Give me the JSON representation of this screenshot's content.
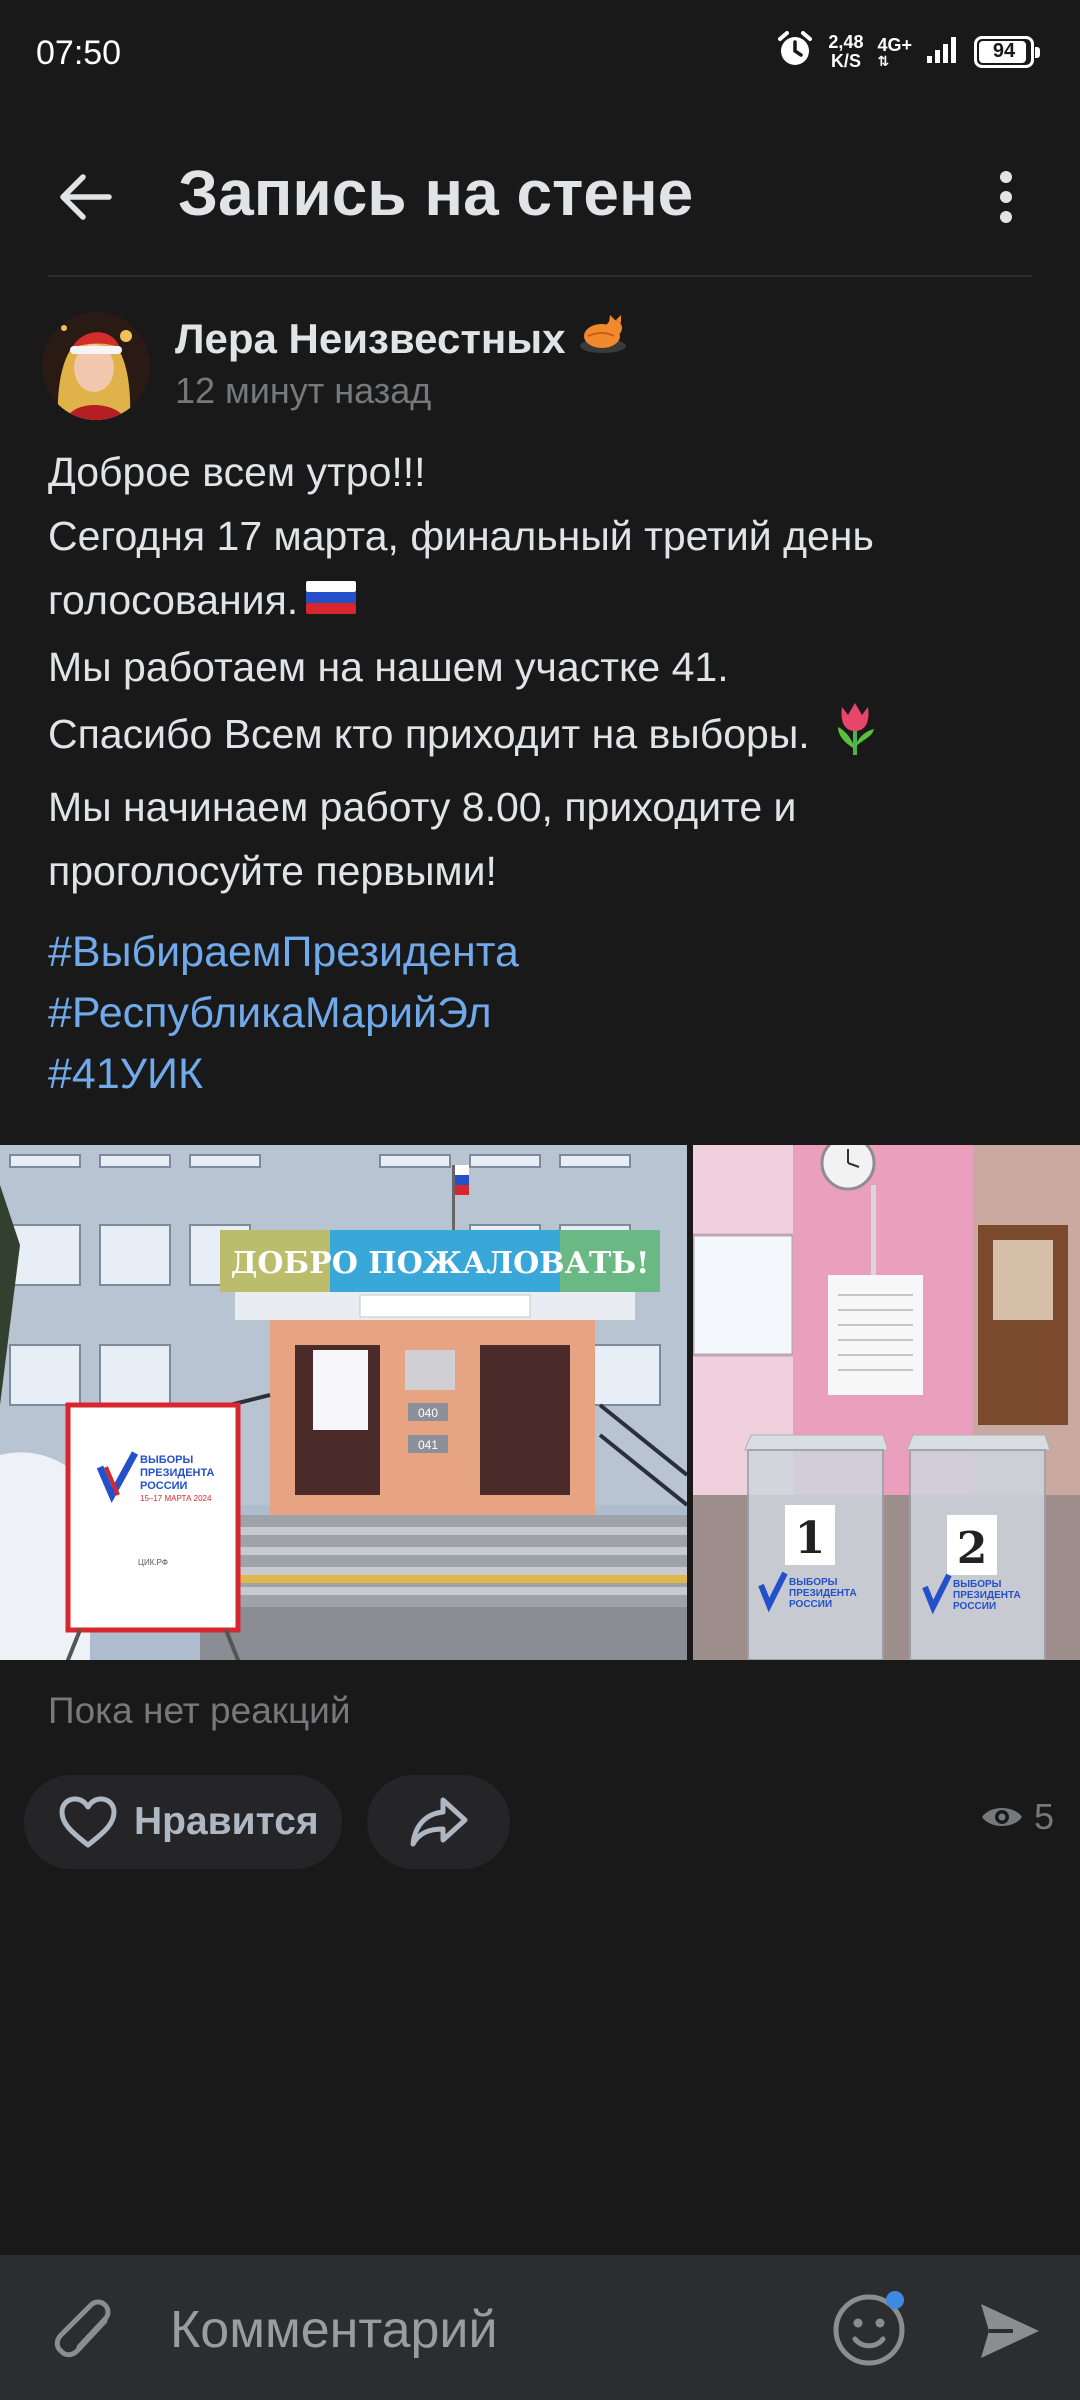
{
  "status_bar": {
    "time": "07:50",
    "net_speed_value": "2,48",
    "net_speed_unit": "K/S",
    "network": "4G+",
    "battery": "94",
    "battery_level": 0.94
  },
  "header": {
    "title": "Запись на стене"
  },
  "post": {
    "author": "Лера Неизвестных",
    "time": "12 минут назад",
    "lines": [
      "Доброе всем утро!!!",
      "Сегодня 17 марта, финальный третий день",
      "голосования.",
      "Мы работаем на нашем участке 41.",
      "Спасибо Всем кто приходит на выборы.",
      "Мы начинаем работу 8.00, приходите и",
      "проголосуйте первыми!"
    ],
    "hashtags": [
      "#ВыбираемПрезидента",
      "#РеспубликаМарийЭл",
      "#41УИК"
    ],
    "photo1": {
      "banner": "ДОБРО ПОЖАЛОВАТЬ!",
      "poster_line1": "ВЫБОРЫ",
      "poster_line2": "ПРЕЗИДЕНТА",
      "poster_line3": "РОССИИ",
      "poster_dates": "15–17 МАРТА 2024",
      "poster_site": "ЦИК.РФ",
      "plate1": "040",
      "plate2": "041"
    },
    "photo2": {
      "box1": "1",
      "box2": "2",
      "label_line1": "ВЫБОРЫ",
      "label_line2": "ПРЕЗИДЕНТА",
      "label_line3": "РОССИИ"
    },
    "reactions_text": "Пока нет реакций",
    "like_label": "Нравится",
    "views": "5"
  },
  "comment": {
    "placeholder": "Комментарий"
  },
  "colors": {
    "background": "#19191a",
    "link": "#71aaeb",
    "secondary_text": "#76787a",
    "button_bg": "#252527",
    "comment_bar": "#2c2d2e"
  }
}
